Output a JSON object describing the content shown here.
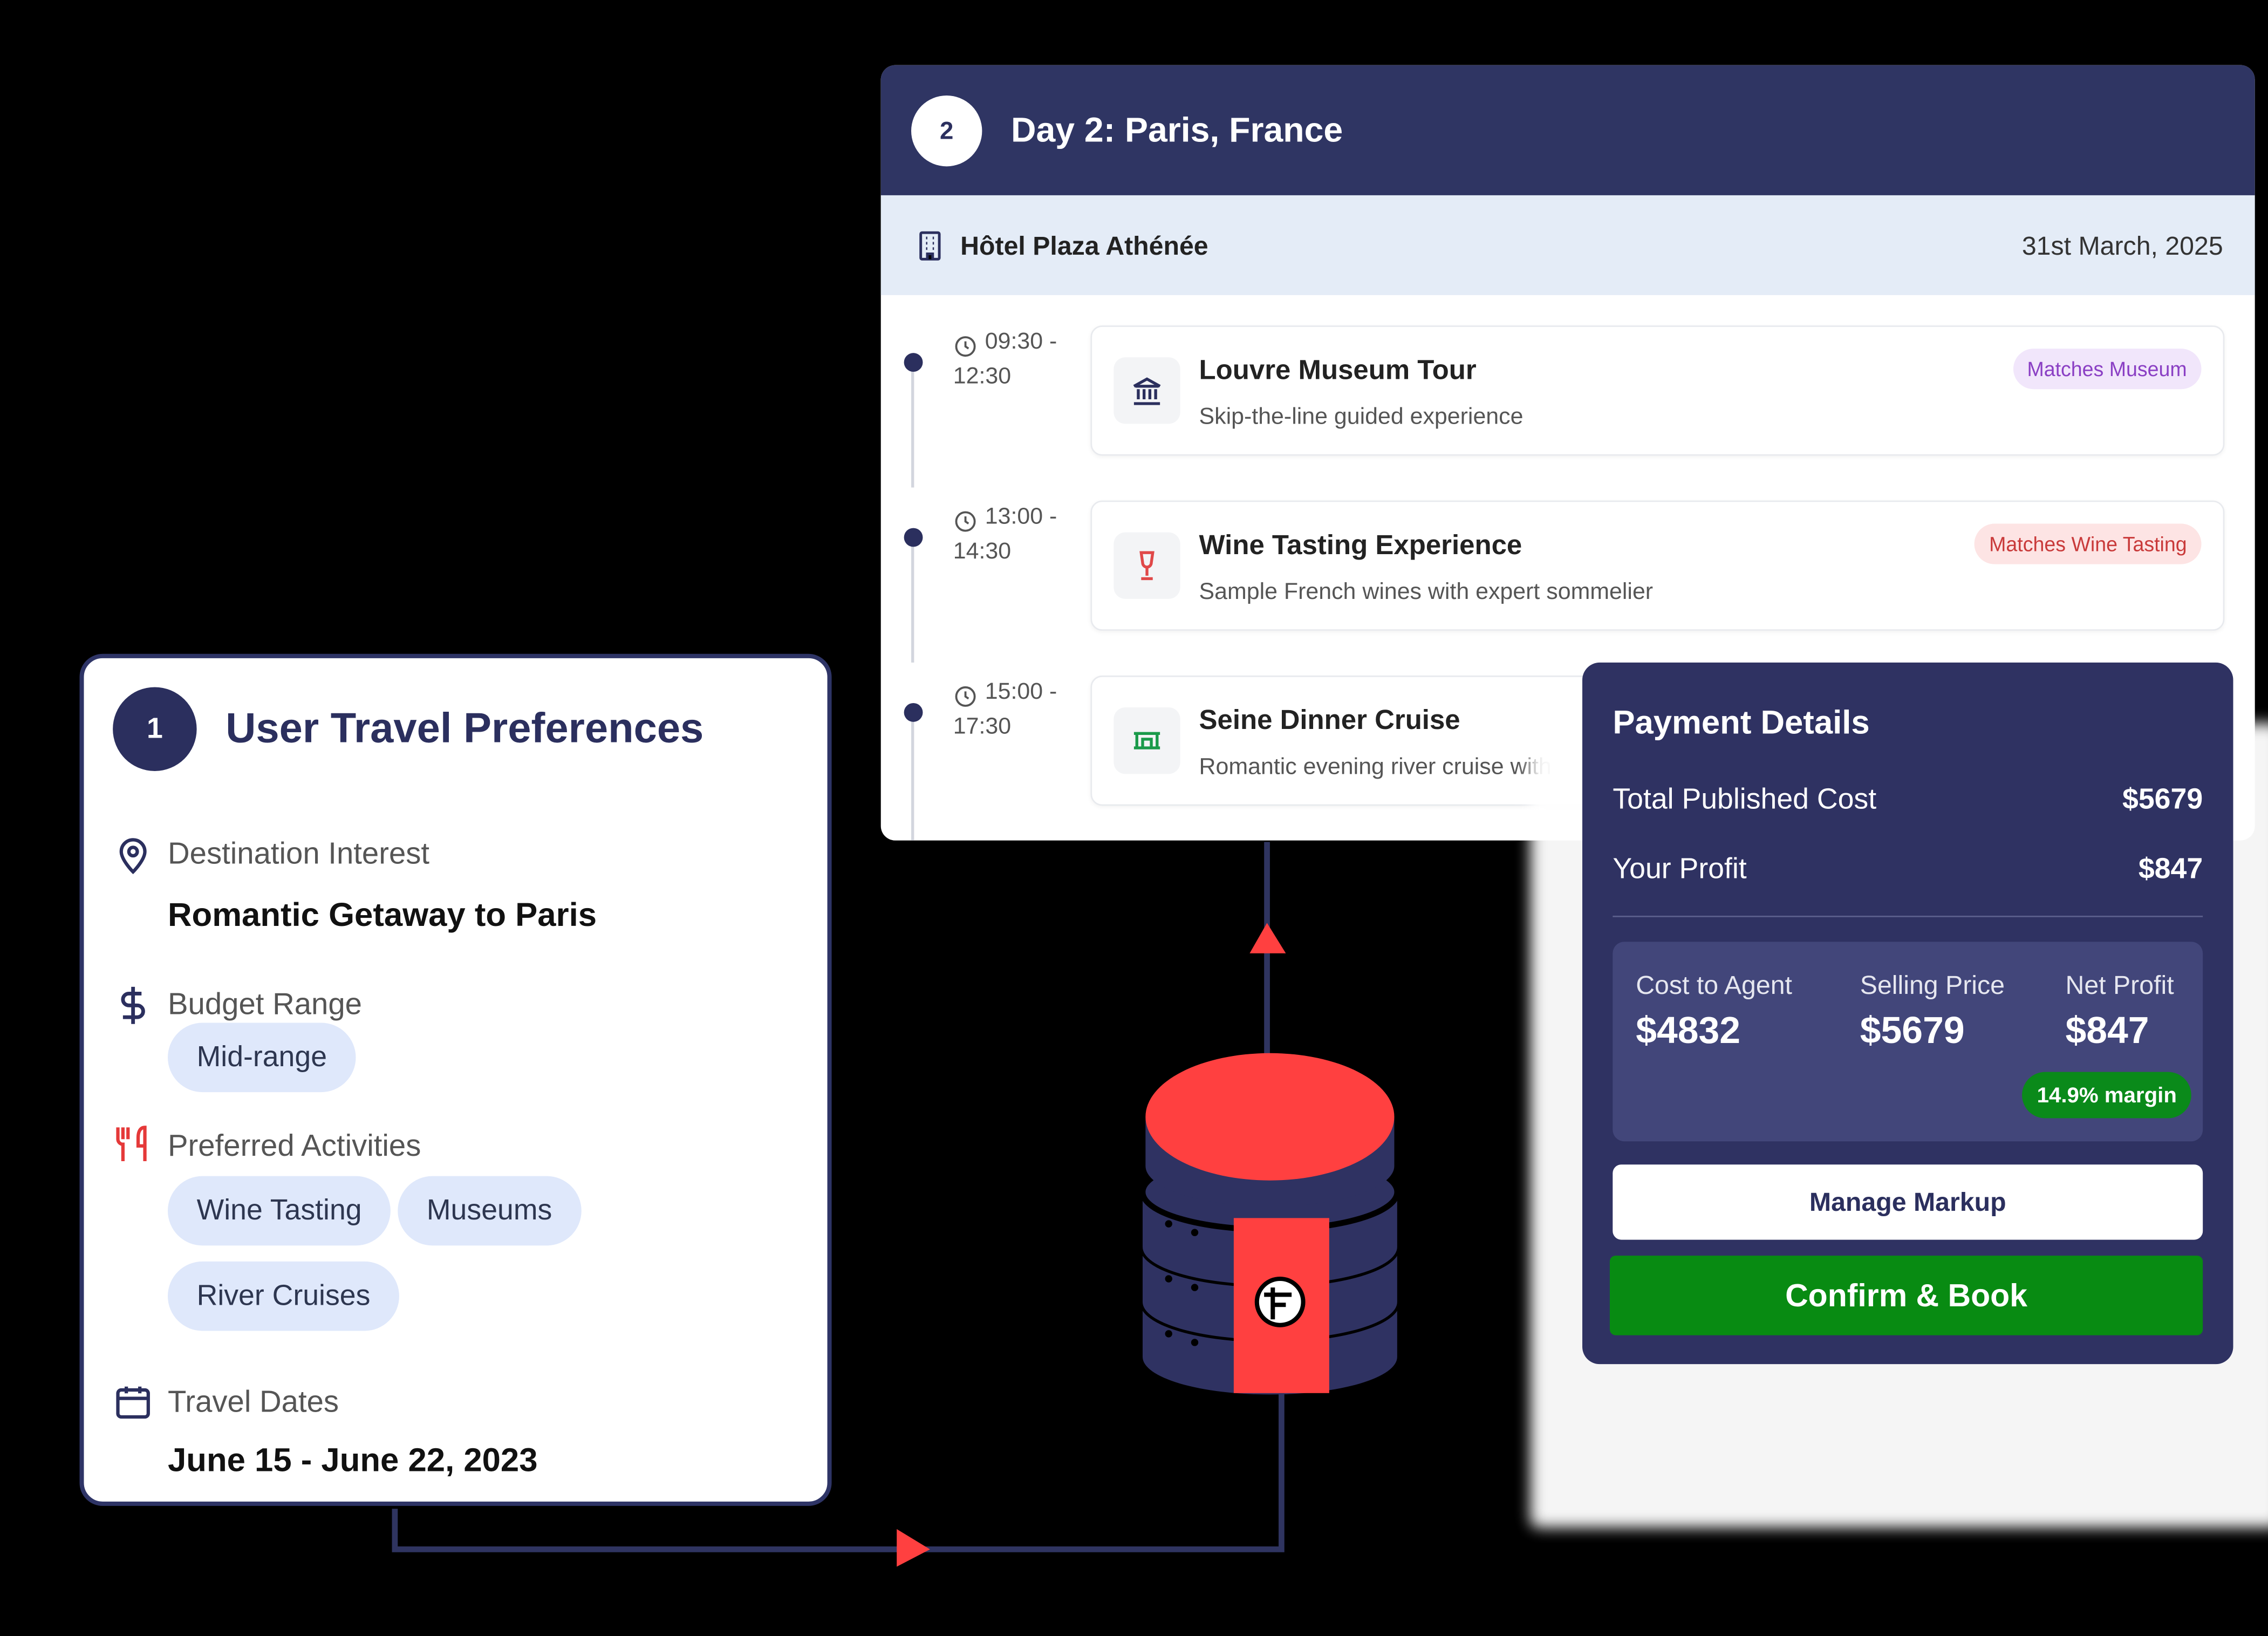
{
  "colors": {
    "navy": "#2b2f5e",
    "accent_red": "#ff4040",
    "confirm_green": "#088b12",
    "pill_blue": "#dfe8fb"
  },
  "preferences": {
    "step": "1",
    "title": "User Travel Preferences",
    "destination": {
      "icon": "map-pin-icon",
      "label": "Destination Interest",
      "value": "Romantic Getaway to Paris"
    },
    "budget": {
      "icon": "dollar-icon",
      "label": "Budget Range",
      "value": "Mid-range"
    },
    "activities": {
      "icon": "utensils-icon",
      "label": "Preferred Activities",
      "items": [
        "Wine Tasting",
        "Museums",
        "River Cruises"
      ]
    },
    "dates": {
      "icon": "calendar-icon",
      "label": "Travel Dates",
      "value": "June 15 - June 22, 2023"
    }
  },
  "itinerary": {
    "step": "2",
    "title": "Day 2: Paris, France",
    "hotel": {
      "icon": "building-icon",
      "name": "Hôtel Plaza Athénée",
      "date": "31st March, 2025"
    },
    "activities": [
      {
        "time_start": "09:30 -",
        "time_end": "12:30",
        "icon": "museum-icon",
        "title": "Louvre Museum Tour",
        "subtitle": "Skip-the-line guided experience",
        "tag": "Matches Museum",
        "tag_bg": "#f1e6fb",
        "tag_color": "#8a3fc4"
      },
      {
        "time_start": "13:00 -",
        "time_end": "14:30",
        "icon": "wine-glass-icon",
        "title": "Wine Tasting Experience",
        "subtitle": "Sample French wines with expert sommelier",
        "tag": "Matches Wine Tasting",
        "tag_bg": "#fde4e4",
        "tag_color": "#c93a3a"
      },
      {
        "time_start": "15:00 -",
        "time_end": "17:30",
        "icon": "ship-icon",
        "title": "Seine Dinner Cruise",
        "subtitle": "Romantic evening river cruise with"
      }
    ]
  },
  "payment": {
    "title": "Payment Details",
    "total_label": "Total Published Cost",
    "total_value": "$5679",
    "profit_label": "Your Profit",
    "profit_value": "$847",
    "breakdown": {
      "cost_label": "Cost to Agent",
      "cost_value": "$4832",
      "sell_label": "Selling Price",
      "sell_value": "$5679",
      "net_label": "Net Profit",
      "net_value": "$847",
      "margin_badge": "14.9% margin"
    },
    "manage_label": "Manage Markup",
    "confirm_label": "Confirm & Book"
  },
  "database_icon": "database-logo-icon"
}
